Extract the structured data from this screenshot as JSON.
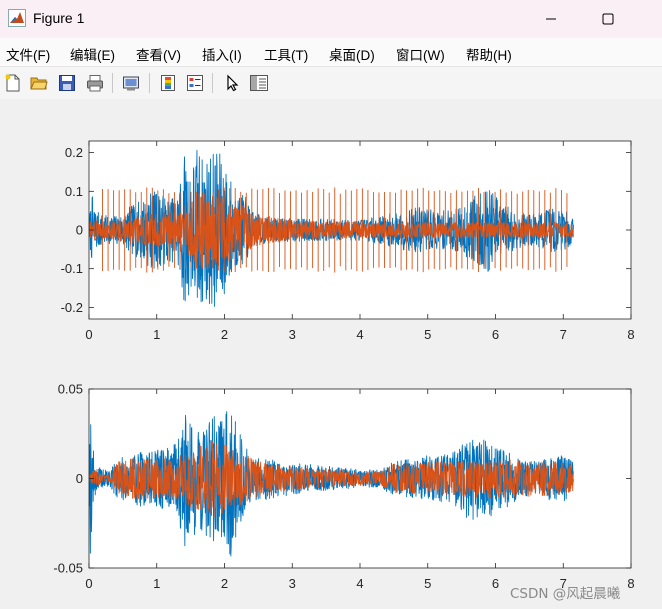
{
  "window": {
    "title": "Figure 1"
  },
  "menu": [
    "文件(F)",
    "编辑(E)",
    "查看(V)",
    "插入(I)",
    "工具(T)",
    "桌面(D)",
    "窗口(W)",
    "帮助(H)"
  ],
  "toolbar": {
    "icons": [
      "new-file-icon",
      "open-folder-icon",
      "save-icon",
      "print-icon",
      "export-figure-icon",
      "colorbar-icon",
      "legend-icon",
      "pointer-icon",
      "property-inspector-icon"
    ]
  },
  "colors": {
    "series1": "#0072bd",
    "series2": "#d95319"
  },
  "chart_data": [
    {
      "type": "line",
      "x_ticks": [
        "0",
        "1",
        "2",
        "3",
        "4",
        "5",
        "6",
        "7",
        "8"
      ],
      "y_ticks": [
        "0.2",
        "0.1",
        "0",
        "-0.1",
        "-0.2"
      ],
      "xlim": [
        0,
        8
      ],
      "ylim": [
        -0.23,
        0.23
      ],
      "x_end": 7.15,
      "series": [
        {
          "color": "#0072bd",
          "envelope": {
            "t": [
              0,
              0.05,
              0.1,
              0.2,
              0.3,
              0.5,
              0.6,
              0.8,
              0.9,
              1.0,
              1.2,
              1.3,
              1.4,
              1.5,
              1.6,
              1.7,
              1.8,
              1.9,
              2.0,
              2.1,
              2.2,
              2.3,
              2.4,
              2.5,
              2.7,
              3.0,
              3.5,
              4.0,
              4.3,
              4.6,
              4.9,
              5.1,
              5.3,
              5.5,
              5.7,
              5.9,
              6.1,
              6.3,
              6.5,
              6.7,
              6.9,
              7.15
            ],
            "a": [
              0.03,
              0.09,
              0.05,
              0.04,
              0.035,
              0.04,
              0.06,
              0.08,
              0.1,
              0.1,
              0.08,
              0.09,
              0.2,
              0.16,
              0.22,
              0.18,
              0.2,
              0.21,
              0.17,
              0.13,
              0.09,
              0.09,
              0.05,
              0.04,
              0.03,
              0.03,
              0.028,
              0.027,
              0.035,
              0.05,
              0.06,
              0.05,
              0.05,
              0.06,
              0.09,
              0.11,
              0.07,
              0.05,
              0.04,
              0.05,
              0.06,
              0.04
            ]
          }
        },
        {
          "color": "#d95319",
          "envelope": {
            "t": [
              0,
              0.1,
              0.2,
              0.3,
              0.5,
              0.8,
              1.0,
              1.3,
              1.5,
              1.7,
              1.9,
              2.1,
              2.3,
              2.5,
              3.0,
              4.0,
              5.0,
              6.0,
              7.0,
              7.15
            ],
            "a": [
              0.02,
              0.03,
              0.02,
              0.025,
              0.03,
              0.04,
              0.045,
              0.05,
              0.08,
              0.1,
              0.1,
              0.08,
              0.06,
              0.04,
              0.025,
              0.02,
              0.02,
              0.02,
              0.02,
              0.02
            ]
          },
          "spikes": {
            "start": 0.2,
            "end": 7.1,
            "interval": 0.0816,
            "amplitude": 0.11
          }
        }
      ]
    },
    {
      "type": "line",
      "x_ticks": [
        "0",
        "1",
        "2",
        "3",
        "4",
        "5",
        "6",
        "7",
        "8"
      ],
      "y_ticks": [
        "0.05",
        "0",
        "-0.05"
      ],
      "xlim": [
        0,
        8
      ],
      "ylim": [
        -0.05,
        0.05
      ],
      "x_end": 7.15,
      "series": [
        {
          "color": "#0072bd",
          "envelope": {
            "t": [
              0,
              0.02,
              0.05,
              0.1,
              0.2,
              0.3,
              0.4,
              0.6,
              0.8,
              1.0,
              1.2,
              1.3,
              1.4,
              1.5,
              1.6,
              1.7,
              1.8,
              1.9,
              2.0,
              2.1,
              2.2,
              2.3,
              2.4,
              2.5,
              2.7,
              3.0,
              3.5,
              4.0,
              4.3,
              4.5,
              4.8,
              5.0,
              5.2,
              5.4,
              5.6,
              5.8,
              6.0,
              6.2,
              6.4,
              6.6,
              6.8,
              7.0,
              7.15
            ],
            "a": [
              0.005,
              0.045,
              0.02,
              0.008,
              0.005,
              0.005,
              0.01,
              0.014,
              0.016,
              0.016,
              0.018,
              0.02,
              0.04,
              0.03,
              0.035,
              0.03,
              0.04,
              0.03,
              0.035,
              0.045,
              0.028,
              0.02,
              0.012,
              0.013,
              0.011,
              0.009,
              0.007,
              0.005,
              0.005,
              0.01,
              0.011,
              0.013,
              0.013,
              0.015,
              0.023,
              0.023,
              0.02,
              0.016,
              0.01,
              0.01,
              0.012,
              0.013,
              0.01
            ]
          }
        },
        {
          "color": "#d95319",
          "envelope": {
            "t": [
              0,
              0.1,
              0.2,
              0.3,
              0.45,
              0.6,
              0.8,
              1.0,
              1.3,
              1.5,
              1.7,
              1.9,
              2.1,
              2.3,
              2.5,
              3.0,
              3.5,
              4.0,
              4.3,
              4.5,
              5.0,
              5.5,
              6.0,
              6.5,
              7.0,
              7.15
            ],
            "a": [
              0.002,
              0.006,
              0.002,
              0.002,
              0.01,
              0.011,
              0.012,
              0.011,
              0.012,
              0.016,
              0.02,
              0.022,
              0.018,
              0.014,
              0.01,
              0.007,
              0.005,
              0.004,
              0.004,
              0.008,
              0.009,
              0.01,
              0.011,
              0.01,
              0.009,
              0.008
            ]
          }
        }
      ]
    }
  ],
  "watermark": "CSDN @风起晨曦"
}
